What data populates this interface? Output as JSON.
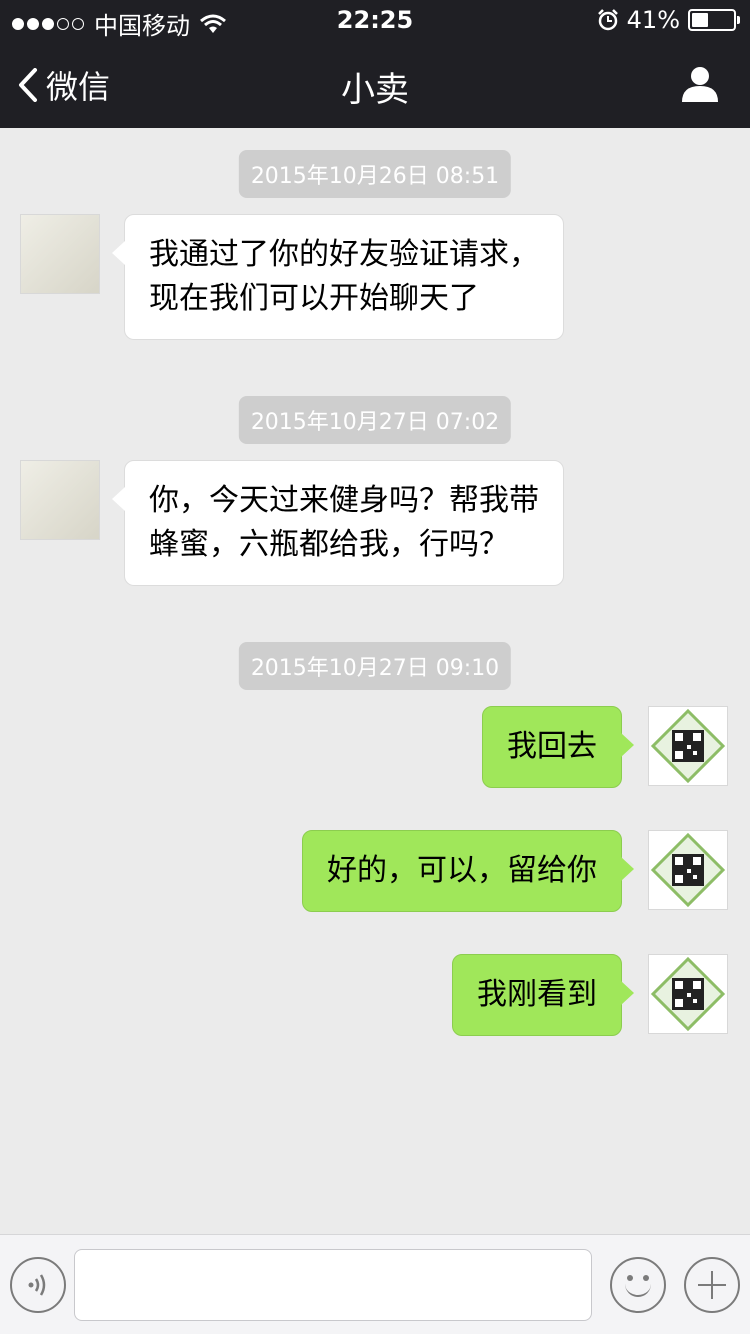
{
  "status_bar": {
    "carrier": "中国移动",
    "time": "22:25",
    "battery": "41%",
    "battery_level": 0.41,
    "signal_bars": 3
  },
  "nav": {
    "back_label": "微信",
    "title": "小卖"
  },
  "messages": [
    {
      "type": "timestamp",
      "text": "2015年10月26日 08:51"
    },
    {
      "type": "text",
      "side": "left",
      "lines": [
        "我通过了你的好友验证请求，",
        "现在我们可以开始聊天了"
      ]
    },
    {
      "type": "timestamp",
      "text": "2015年10月27日 07:02"
    },
    {
      "type": "text",
      "side": "left",
      "lines": [
        "你，今天过来健身吗？帮我带",
        "蜂蜜，六瓶都给我，行吗？"
      ]
    },
    {
      "type": "timestamp",
      "text": "2015年10月27日 09:10"
    },
    {
      "type": "text",
      "side": "right",
      "lines": [
        "我回去"
      ]
    },
    {
      "type": "text",
      "side": "right",
      "lines": [
        "好的，可以，留给你"
      ]
    },
    {
      "type": "text",
      "side": "right",
      "lines": [
        "我刚看到"
      ]
    }
  ],
  "input": {
    "placeholder": ""
  },
  "colors": {
    "nav_bg": "#1f1f24",
    "chat_bg": "#ebebeb",
    "bubble_sent": "#a0e75a",
    "bubble_received": "#ffffff"
  }
}
